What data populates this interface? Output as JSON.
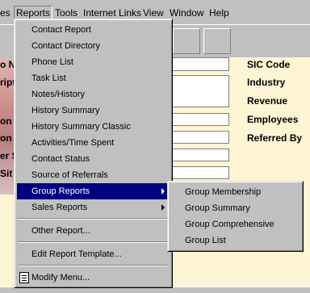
{
  "menubar": {
    "items": [
      {
        "label": "es"
      },
      {
        "label": "Reports"
      },
      {
        "label": "Tools"
      },
      {
        "label": "Internet Links"
      },
      {
        "label": "View"
      },
      {
        "label": "Window"
      },
      {
        "label": "Help"
      }
    ]
  },
  "background_form": {
    "left_fragments": [
      "o N",
      "ripti",
      "on",
      "on",
      "er S",
      "Sit"
    ],
    "right_labels": [
      "SIC Code",
      "Industry",
      "Revenue",
      "Employees",
      "Referred By"
    ]
  },
  "reports_menu": {
    "items": [
      {
        "label": "Contact Report"
      },
      {
        "label": "Contact Directory"
      },
      {
        "label": "Phone List"
      },
      {
        "label": "Task List"
      },
      {
        "label": "Notes/History"
      },
      {
        "label": "History Summary"
      },
      {
        "label": "History Summary Classic"
      },
      {
        "label": "Activities/Time Spent"
      },
      {
        "label": "Contact Status"
      },
      {
        "label": "Source of Referrals"
      },
      {
        "label": "Group Reports",
        "submenu": true,
        "highlighted": true
      },
      {
        "label": "Sales Reports",
        "submenu": true
      },
      {
        "label": "Other Report..."
      },
      {
        "label": "Edit Report Template..."
      },
      {
        "label": "Modify Menu..."
      }
    ]
  },
  "group_submenu": {
    "items": [
      {
        "label": "Group Membership"
      },
      {
        "label": "Group Summary"
      },
      {
        "label": "Group Comprehensive"
      },
      {
        "label": "Group List"
      }
    ]
  },
  "colors": {
    "highlight": "#000080",
    "menu_bg": "#c0c0c0",
    "form_bg": "#fdf5d4"
  }
}
